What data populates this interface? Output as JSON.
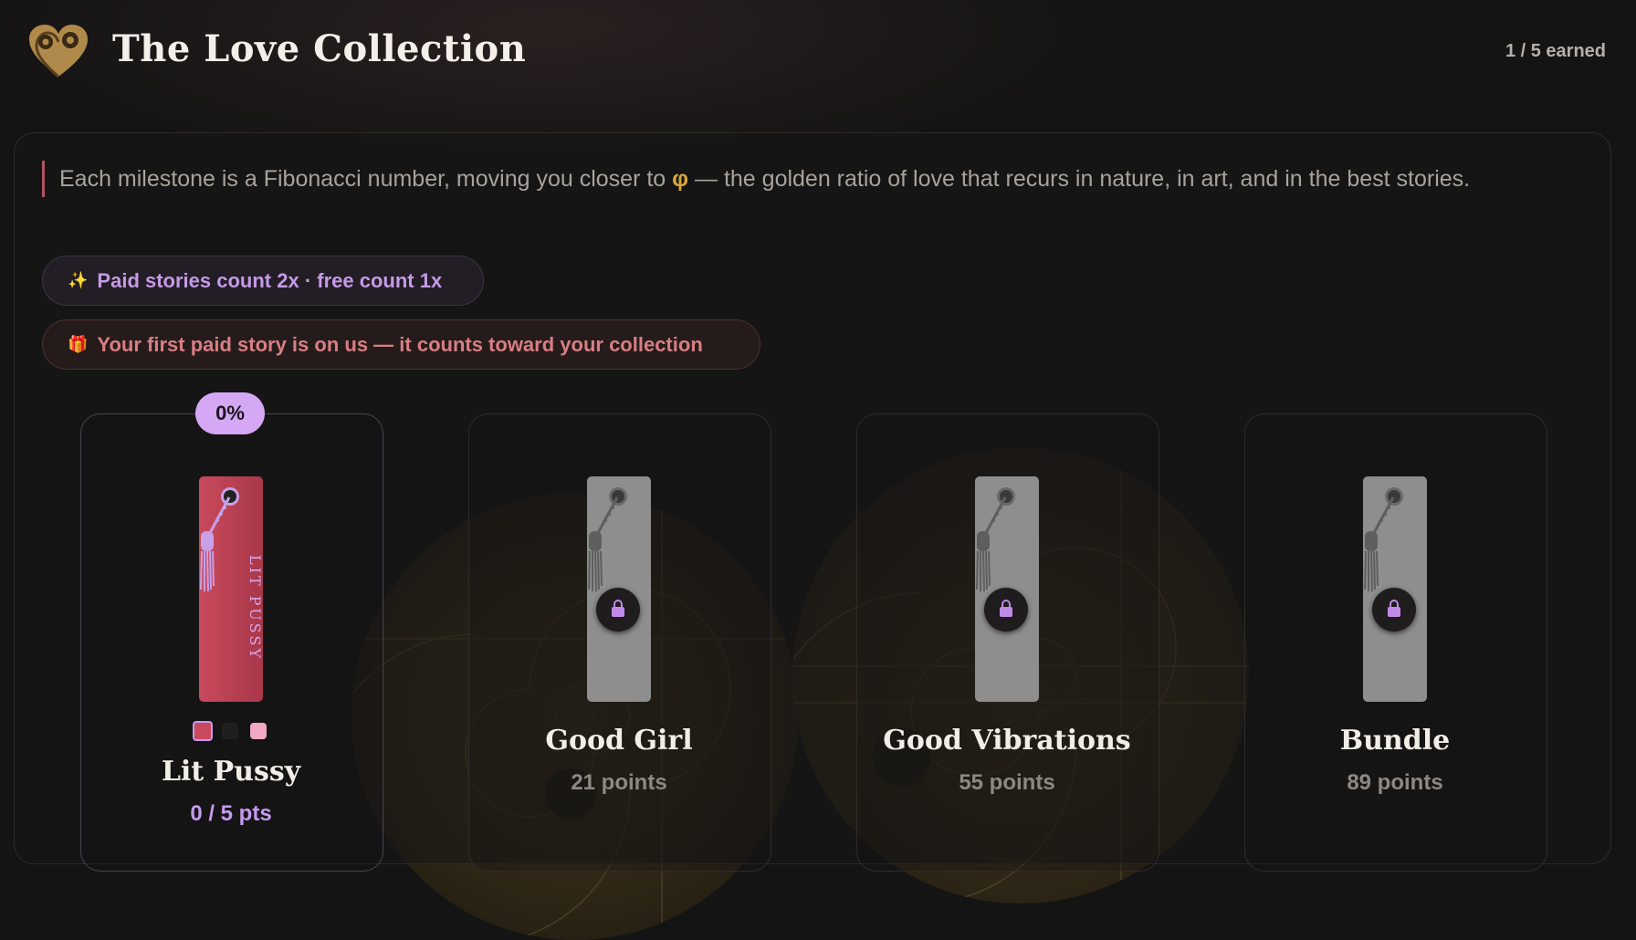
{
  "header": {
    "title": "The Love Collection",
    "earned": "1 / 5 earned"
  },
  "intro": {
    "text_before": "Each milestone is a Fibonacci number, moving you closer to",
    "phi": "φ",
    "text_after": "— the golden ratio of love that recurs in nature, in art, and in the best stories."
  },
  "pills": {
    "paid": {
      "icon": "✨",
      "label": "Paid stories count 2x · free count 1x"
    },
    "gift": {
      "icon": "🎁",
      "label": "Your first paid story is on us — it counts toward your collection"
    }
  },
  "cards": [
    {
      "name": "Lit Pussy",
      "progress": "0 / 5 pts",
      "badge": "0%",
      "tag_text": "LIT PUSSY",
      "state": "active",
      "swatches": [
        "#c84a5c",
        "#1f1f1f",
        "#f0a8c4"
      ]
    },
    {
      "name": "Good Girl",
      "progress": "21 points",
      "state": "locked"
    },
    {
      "name": "Good Vibrations",
      "progress": "55 points",
      "state": "locked"
    },
    {
      "name": "Bundle",
      "progress": "89 points",
      "state": "locked"
    }
  ],
  "colors": {
    "accent": "#c69af0",
    "rose": "#c84a5c",
    "gold": "#d8a63e"
  },
  "icons": {
    "logo": "heart-spiral-icon",
    "lock": "lock-icon",
    "tassel": "tassel-icon"
  }
}
